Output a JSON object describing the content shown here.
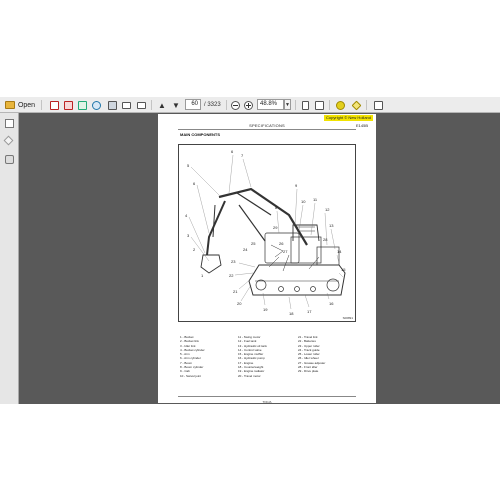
{
  "toolbar": {
    "open_label": "Open",
    "page_current": "60",
    "page_total": "/ 3323",
    "zoom": "48.8%",
    "colors": {
      "bar": "#ececec",
      "folder": "#e8b53c",
      "highlight": "#e3cf1c"
    }
  },
  "document": {
    "header_title": "SPECIFICATIONS",
    "copyright": "Copyright © New Holland",
    "header_code": "E145B",
    "section_title": "MAIN COMPONENTS",
    "figure_code": "S00891",
    "legend_col1": [
      "1 - Bucket",
      "2 - Bucket link",
      "3 - Idler link",
      "4 - Bucket cylinder",
      "5 - Arm",
      "6 - Arm cylinder",
      "7 - Boom",
      "8 - Boom cylinder",
      "9 - Cab",
      "10 - Swivel joint"
    ],
    "legend_col2": [
      "11 - Swing motor",
      "12 - Fuel tank",
      "13 - Hydraulic oil tank",
      "14 - Control valve",
      "15 - Engine muffler",
      "16 - Hydraulic pump",
      "17 - Engine",
      "18 - Counterweight",
      "19 - Engine radiator",
      "20 - Travel motor"
    ],
    "legend_col3": [
      "21 - Travel link",
      "22 - Batteries",
      "23 - Upper roller",
      "24 - Track guide",
      "25 - Lower roller",
      "26 - Idler wheel",
      "27 - Grease adjuster",
      "28 - Front idler",
      "29 - Drive plate"
    ],
    "footer": "TOC/A"
  }
}
